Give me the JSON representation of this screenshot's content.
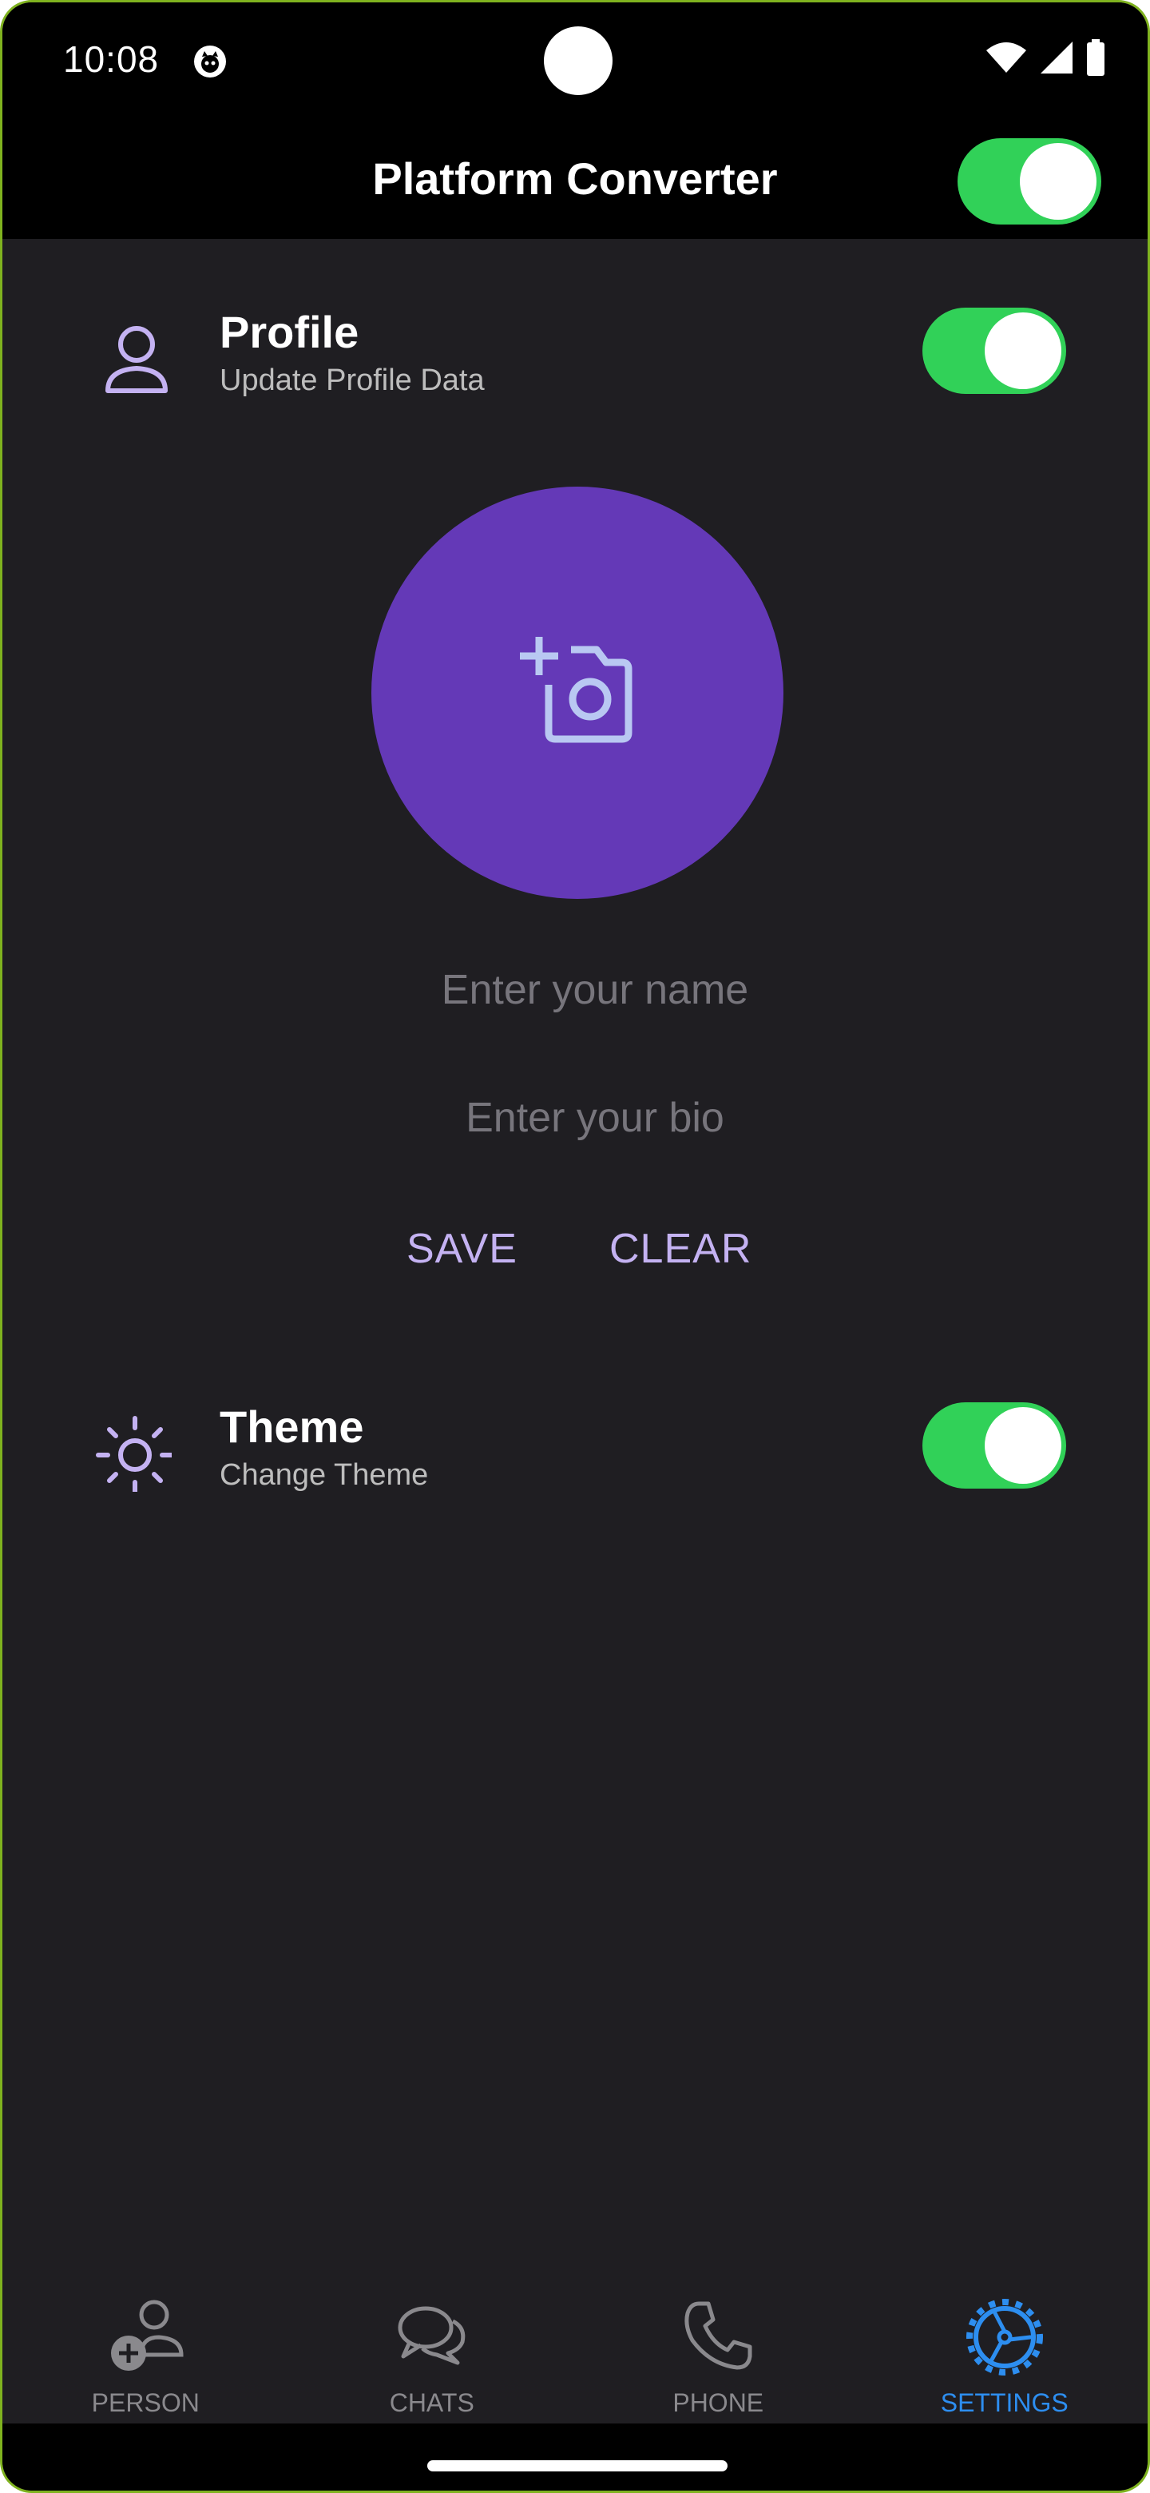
{
  "status_bar": {
    "time": "10:08"
  },
  "app_bar": {
    "title": "Platform Converter",
    "platform_switch_on": true
  },
  "profile": {
    "title": "Profile",
    "subtitle": "Update Profile Data",
    "switch_on": true,
    "avatar_color": "#6439b7",
    "name_placeholder": "Enter your name",
    "bio_placeholder": "Enter your bio",
    "save_label": "SAVE",
    "clear_label": "CLEAR"
  },
  "theme": {
    "title": "Theme",
    "subtitle": "Change Theme",
    "switch_on": true
  },
  "bottom_nav": {
    "items": [
      {
        "label": "PERSON",
        "icon": "person-add-icon",
        "active": false
      },
      {
        "label": "CHATS",
        "icon": "chats-icon",
        "active": false
      },
      {
        "label": "PHONE",
        "icon": "phone-icon",
        "active": false
      },
      {
        "label": "SETTINGS",
        "icon": "settings-icon",
        "active": true
      }
    ]
  },
  "colors": {
    "background": "#1f1e22",
    "bar": "#000000",
    "switch_on": "#31d158",
    "accent_text": "#c4b2f2",
    "active_nav": "#2d8ef0",
    "inactive_nav": "#8a898d"
  }
}
